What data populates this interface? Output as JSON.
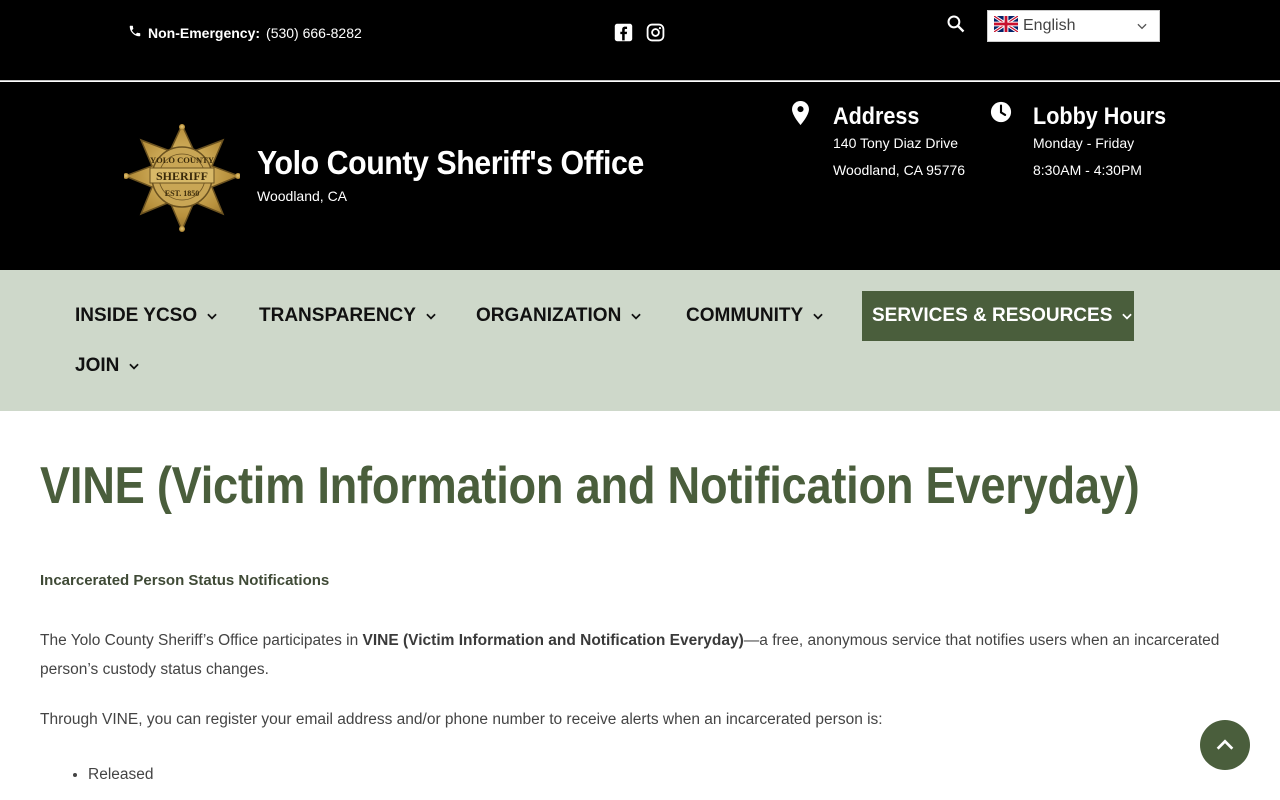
{
  "topbar": {
    "phone_label": "Non-Emergency:",
    "phone_number": "(530) 666-8282",
    "language": "English"
  },
  "header": {
    "badge_text_top": "YOLO COUNTY",
    "badge_text_mid": "SHERIFF",
    "badge_text_bottom": "EST. 1850",
    "site_title": "Yolo County Sheriff's Office",
    "site_subtitle": "Woodland, CA",
    "address_heading": "Address",
    "address_line1": "140 Tony Diaz Drive",
    "address_line2": "Woodland, CA 95776",
    "hours_heading": "Lobby Hours",
    "hours_line1": "Monday - Friday",
    "hours_line2": "8:30AM - 4:30PM"
  },
  "nav": {
    "items": [
      {
        "label": "INSIDE YCSO"
      },
      {
        "label": "TRANSPARENCY"
      },
      {
        "label": "ORGANIZATION"
      },
      {
        "label": "COMMUNITY"
      },
      {
        "label": "SERVICES & RESOURCES"
      },
      {
        "label": "JOIN"
      }
    ],
    "active_item": "SERVICES & RESOURCES"
  },
  "content": {
    "title": "VINE (Victim Information and Notification Everyday)",
    "subheading": "Incarcerated Person Status Notifications",
    "p1_start": "The Yolo County Sheriff’s Office participates in ",
    "p1_bold": "VINE (Victim Information and Notification Everyday)",
    "p1_end": "—a free, anonymous service that notifies users when an incarcerated person’s custody status changes.",
    "p2": "Through VINE, you can register your email address and/or phone number to receive alerts when an incarcerated person is:",
    "list": [
      "Released"
    ]
  },
  "colors": {
    "brand_green": "#4a5e3c",
    "nav_bg": "#ced8ca",
    "header_bg": "#000000"
  },
  "icons": {
    "phone": "phone-icon",
    "facebook": "facebook-icon",
    "instagram": "instagram-icon",
    "search": "search-icon",
    "flag": "uk-flag-icon",
    "address": "map-pin-icon",
    "hours": "clock-icon",
    "scroll_top": "chevron-up-icon"
  }
}
